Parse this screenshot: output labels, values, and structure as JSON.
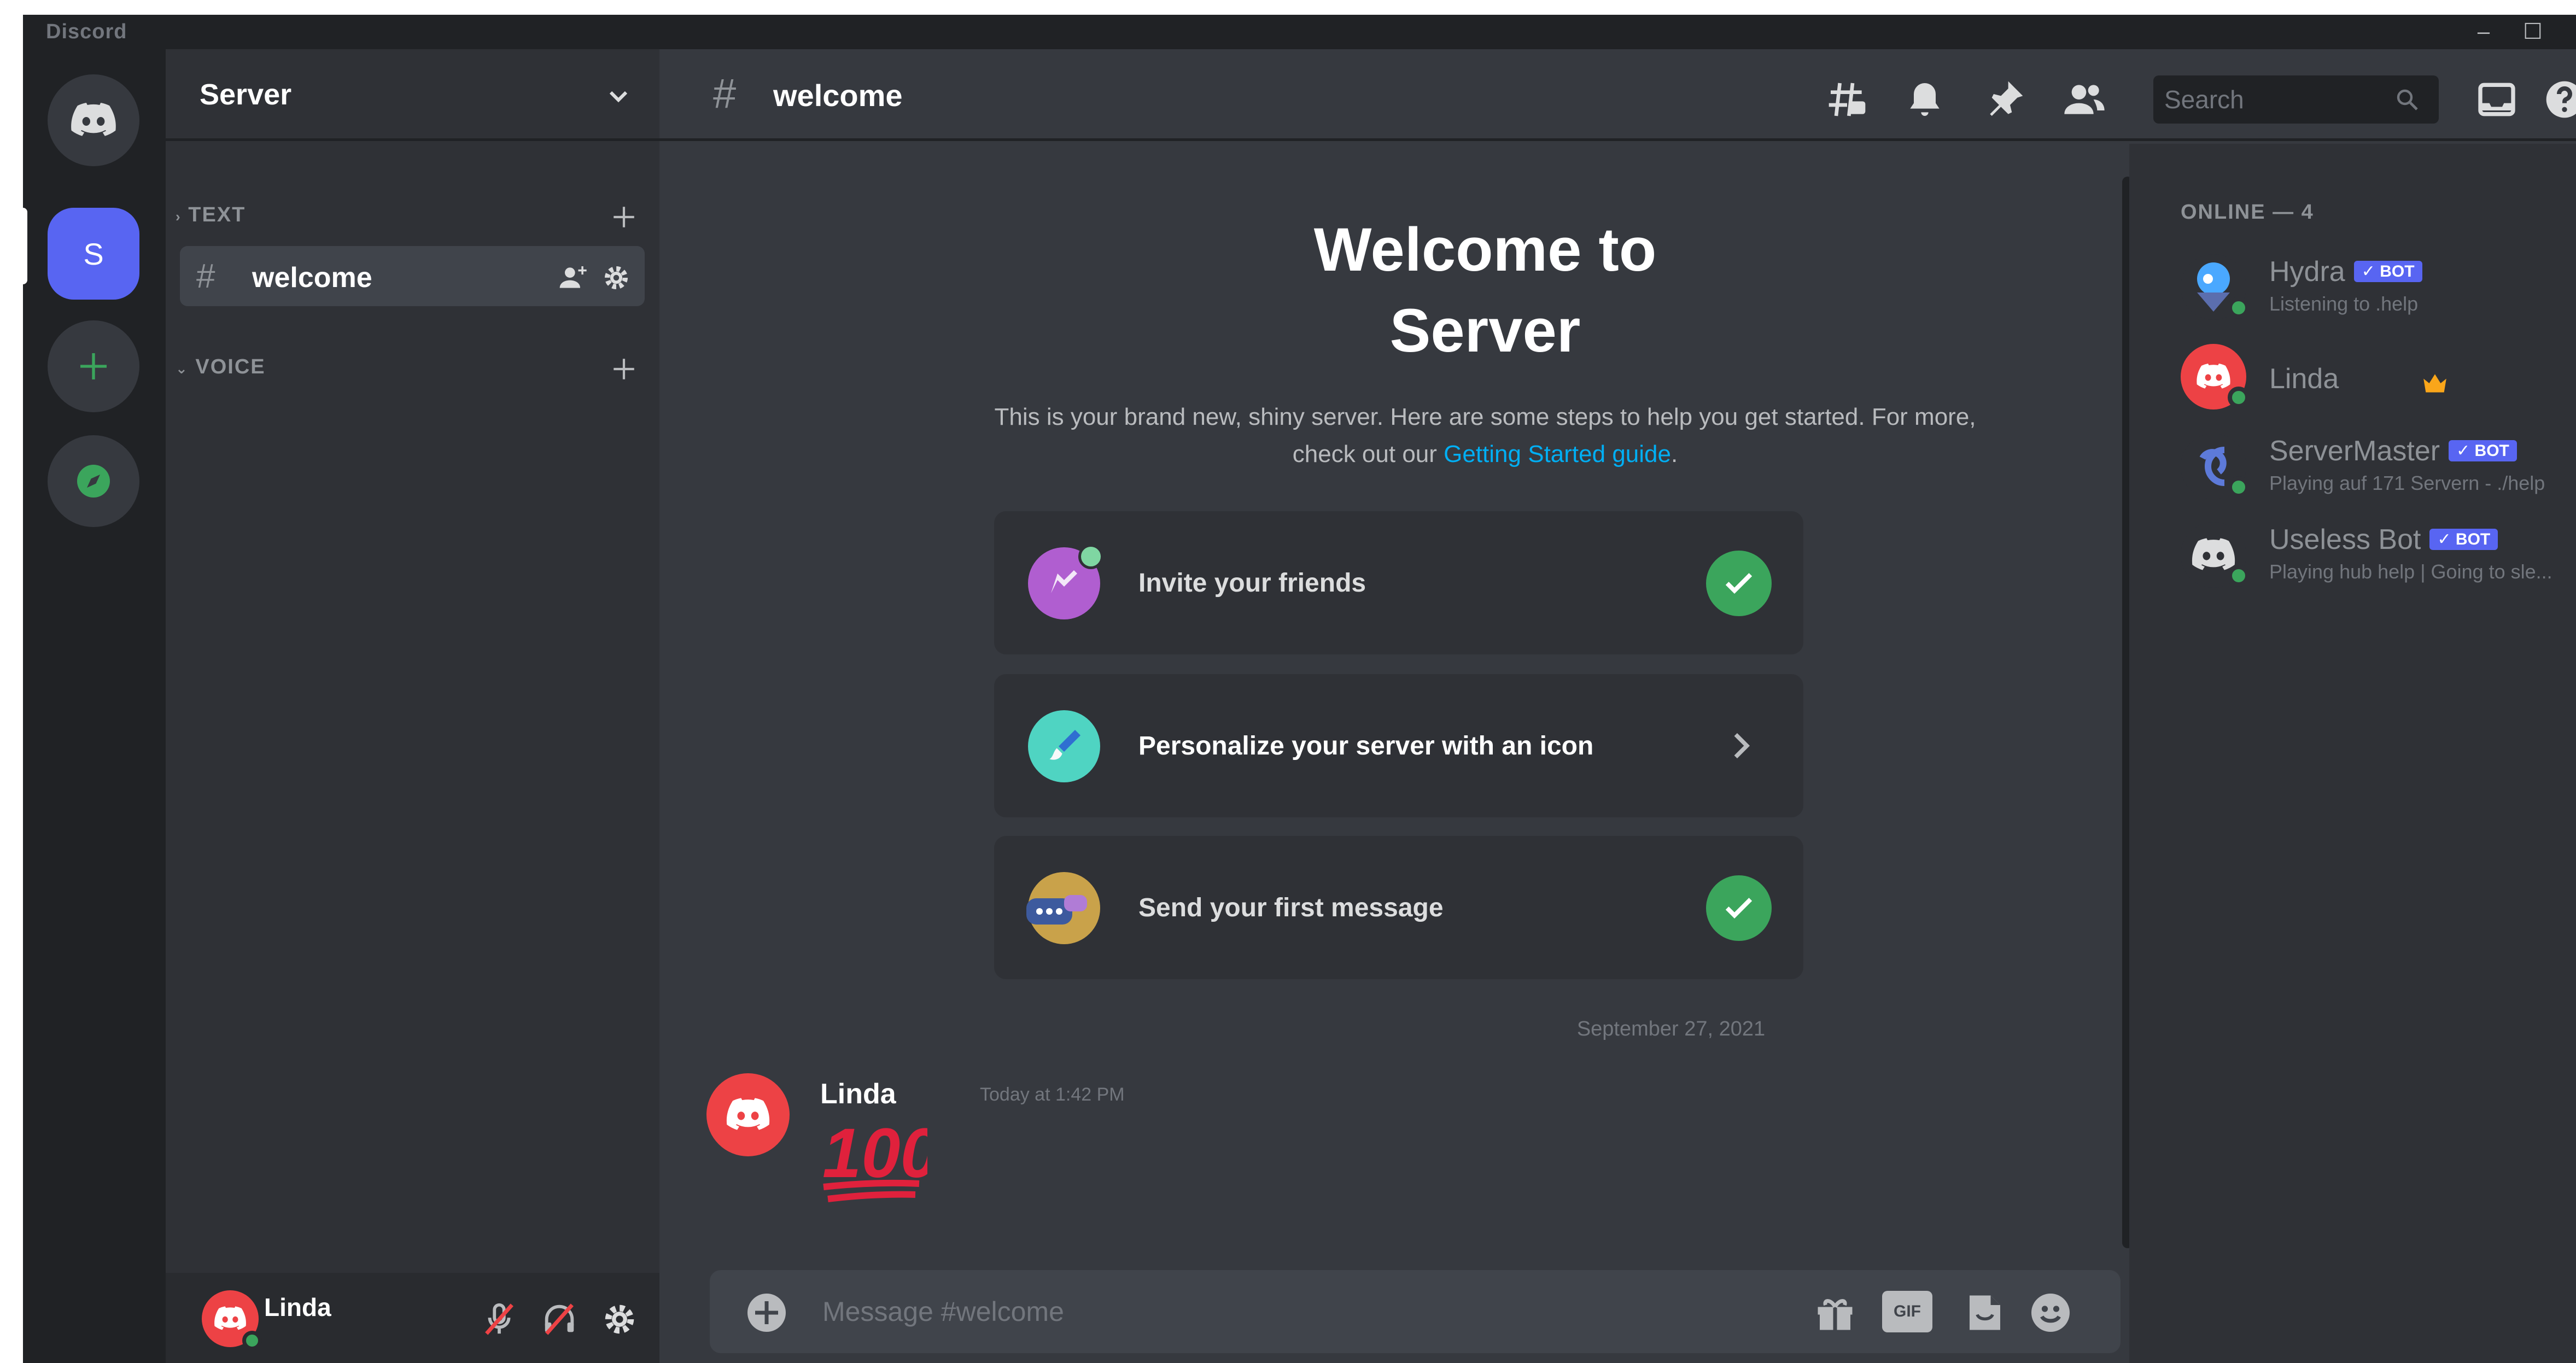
{
  "window": {
    "title": "Discord",
    "minimize": "–",
    "maximize": "☐"
  },
  "rail": {
    "server_initial": "S"
  },
  "sidebar": {
    "server_name": "Server",
    "categories": {
      "text": "TEXT",
      "voice": "VOICE"
    },
    "channels": [
      {
        "name": "welcome"
      }
    ],
    "user": {
      "name": "Linda"
    }
  },
  "header": {
    "channel": "welcome",
    "search_placeholder": "Search"
  },
  "welcome": {
    "title": "Welcome to Server",
    "description": "This is your brand new, shiny server. Here are some steps to help you get started. For more, check out our ",
    "link": "Getting Started guide",
    "steps": [
      {
        "label": "Invite your friends",
        "done": true
      },
      {
        "label": "Personalize your server with an icon",
        "done": false
      },
      {
        "label": "Send your first message",
        "done": true
      }
    ]
  },
  "messages": {
    "date_separator": "September 27, 2021",
    "items": [
      {
        "author": "Linda",
        "time": "Today at 1:42 PM",
        "emoji": "100"
      }
    ]
  },
  "composer": {
    "placeholder": "Message #welcome",
    "gif_label": "GIF"
  },
  "members": {
    "header": "ONLINE — 4",
    "bot_badge": "✓ BOT",
    "list": [
      {
        "name": "Hydra",
        "bot": true,
        "activity": "Listening to .help",
        "color": "#3ba55c"
      },
      {
        "name": "Linda",
        "bot": false,
        "activity": "",
        "owner": true
      },
      {
        "name": "ServerMaster",
        "bot": true,
        "activity": "Playing auf 171 Servern - ./help"
      },
      {
        "name": "Useless Bot",
        "bot": true,
        "activity": "Playing hub help | Going to sle..."
      }
    ]
  },
  "colors": {
    "accent": "#5865f2",
    "online": "#3ba55c",
    "danger": "#ed4245",
    "link": "#00aff4"
  }
}
